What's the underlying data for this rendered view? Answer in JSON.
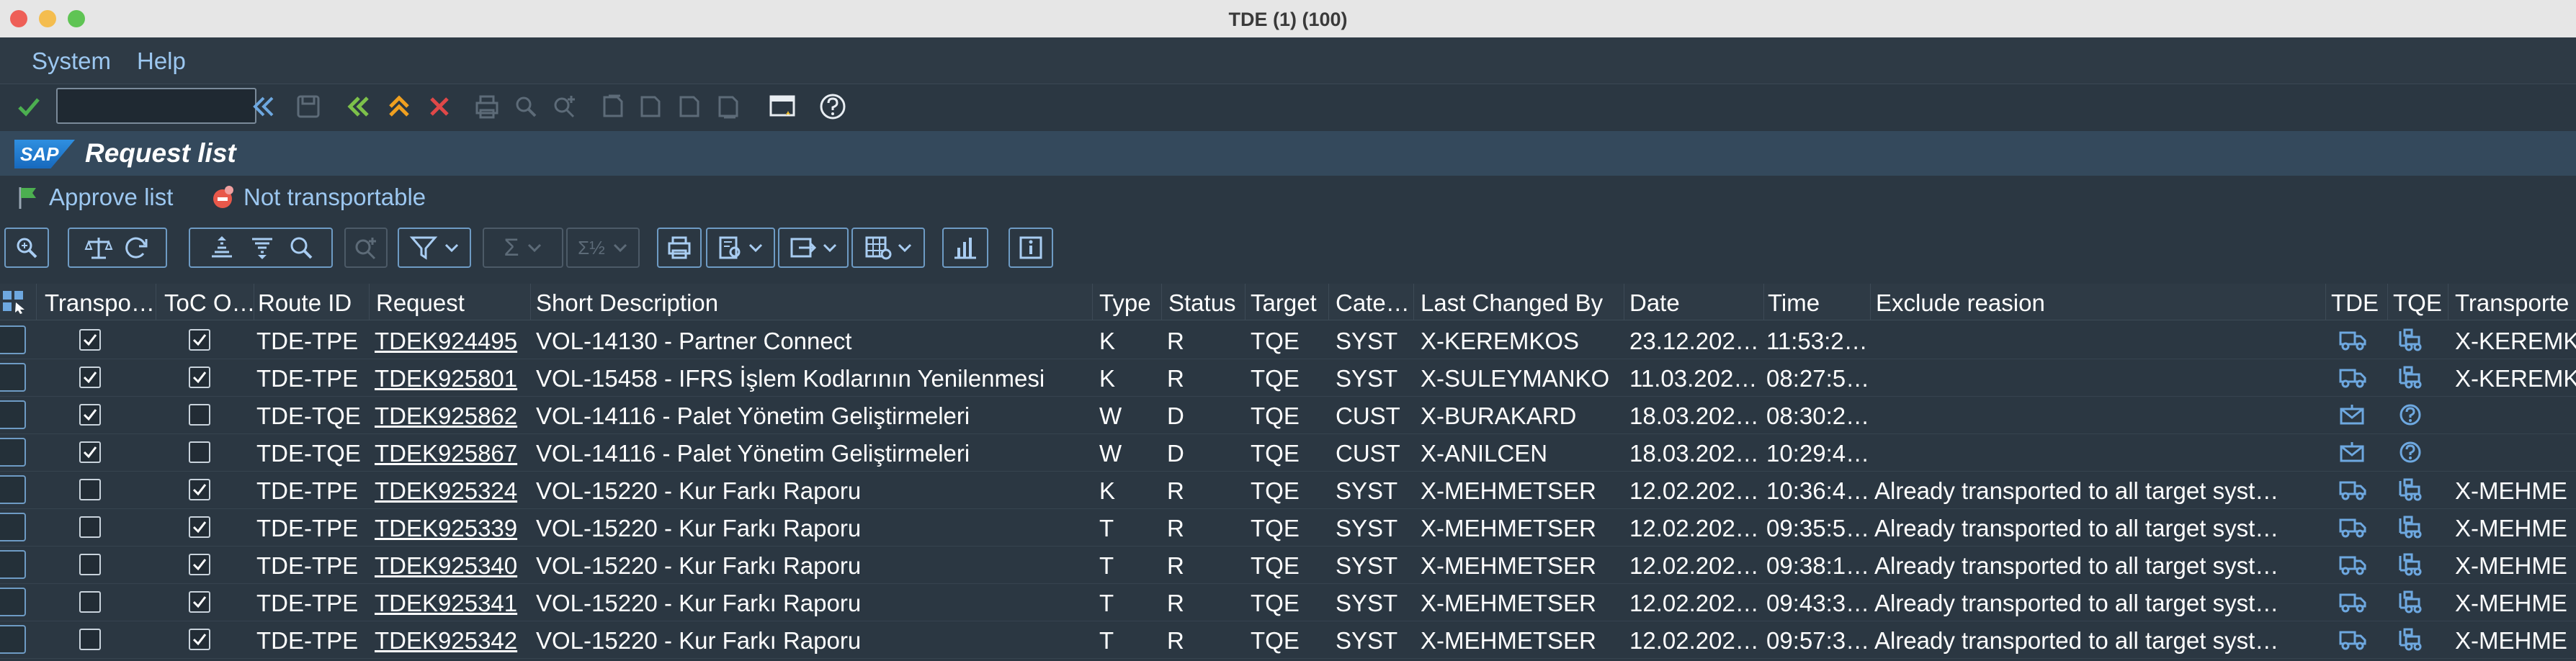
{
  "window": {
    "title": "TDE (1) (100)"
  },
  "menu": {
    "items": [
      "System",
      "Help"
    ]
  },
  "command_field": {
    "value": ""
  },
  "header": {
    "title": "Request list",
    "logo_text": "SAP"
  },
  "app_toolbar": {
    "approve_label": "Approve list",
    "not_transportable_label": "Not transportable"
  },
  "colors": {
    "link": "#9cc7f0",
    "background": "#2b3742",
    "header_bg": "#34495c",
    "approve_ok": "#4caf50",
    "cancel_red": "#e04848"
  },
  "table": {
    "columns": [
      "Transpo…",
      "ToC O…",
      "Route ID",
      "Request",
      "Short Description",
      "Type",
      "Status",
      "Target",
      "Cate…",
      "Last Changed By",
      "Date",
      "Time",
      "Exclude reasion",
      "TDE",
      "TQE",
      "Transporte"
    ],
    "rows": [
      {
        "transport": true,
        "toc": true,
        "route": "TDE-TPE",
        "request": "TDEK924495",
        "desc": "VOL-14130 - Partner Connect",
        "type": "K",
        "status": "R",
        "target": "TQE",
        "cate": "SYST",
        "changed_by": "X-KEREMKOS",
        "date": "23.12.202…",
        "time": "11:53:2…",
        "exclude": "",
        "tde_icon": "truck-icon",
        "tqe_icon": "forklift-icon",
        "transporter": "X-KEREMK"
      },
      {
        "transport": true,
        "toc": true,
        "route": "TDE-TPE",
        "request": "TDEK925801",
        "desc": "VOL-15458 -  IFRS İşlem Kodlarının Yenilenmesi",
        "type": "K",
        "status": "R",
        "target": "TQE",
        "cate": "SYST",
        "changed_by": "X-SULEYMANKO",
        "date": "11.03.202…",
        "time": "08:27:5…",
        "exclude": "",
        "tde_icon": "truck-icon",
        "tqe_icon": "forklift-icon",
        "transporter": "X-KEREMK"
      },
      {
        "transport": true,
        "toc": false,
        "route": "TDE-TQE",
        "request": "TDEK925862",
        "desc": "VOL-14116 - Palet Yönetim Geliştirmeleri",
        "type": "W",
        "status": "D",
        "target": "TQE",
        "cate": "CUST",
        "changed_by": "X-BURAKARD",
        "date": "18.03.202…",
        "time": "08:30:2…",
        "exclude": "",
        "tde_icon": "envelope-icon",
        "tqe_icon": "question-icon",
        "transporter": ""
      },
      {
        "transport": true,
        "toc": false,
        "route": "TDE-TQE",
        "request": "TDEK925867",
        "desc": "VOL-14116 - Palet Yönetim Geliştirmeleri",
        "type": "W",
        "status": "D",
        "target": "TQE",
        "cate": "CUST",
        "changed_by": "X-ANILCEN",
        "date": "18.03.202…",
        "time": "10:29:4…",
        "exclude": "",
        "tde_icon": "envelope-icon",
        "tqe_icon": "question-icon",
        "transporter": ""
      },
      {
        "transport": false,
        "toc": true,
        "route": "TDE-TPE",
        "request": "TDEK925324",
        "desc": "VOL-15220 - Kur Farkı Raporu",
        "type": "K",
        "status": "R",
        "target": "TQE",
        "cate": "SYST",
        "changed_by": "X-MEHMETSER",
        "date": "12.02.202…",
        "time": "10:36:4…",
        "exclude": "Already transported to all target syst…",
        "tde_icon": "truck-icon",
        "tqe_icon": "forklift-icon",
        "transporter": "X-MEHME"
      },
      {
        "transport": false,
        "toc": true,
        "route": "TDE-TPE",
        "request": "TDEK925339",
        "desc": "VOL-15220 - Kur Farkı Raporu",
        "type": "T",
        "status": "R",
        "target": "TQE",
        "cate": "SYST",
        "changed_by": "X-MEHMETSER",
        "date": "12.02.202…",
        "time": "09:35:5…",
        "exclude": "Already transported to all target syst…",
        "tde_icon": "truck-icon",
        "tqe_icon": "forklift-icon",
        "transporter": "X-MEHME"
      },
      {
        "transport": false,
        "toc": true,
        "route": "TDE-TPE",
        "request": "TDEK925340",
        "desc": "VOL-15220 - Kur Farkı Raporu",
        "type": "T",
        "status": "R",
        "target": "TQE",
        "cate": "SYST",
        "changed_by": "X-MEHMETSER",
        "date": "12.02.202…",
        "time": "09:38:1…",
        "exclude": "Already transported to all target syst…",
        "tde_icon": "truck-icon",
        "tqe_icon": "forklift-icon",
        "transporter": "X-MEHME"
      },
      {
        "transport": false,
        "toc": true,
        "route": "TDE-TPE",
        "request": "TDEK925341",
        "desc": "VOL-15220 - Kur Farkı Raporu",
        "type": "T",
        "status": "R",
        "target": "TQE",
        "cate": "SYST",
        "changed_by": "X-MEHMETSER",
        "date": "12.02.202…",
        "time": "09:43:3…",
        "exclude": "Already transported to all target syst…",
        "tde_icon": "truck-icon",
        "tqe_icon": "forklift-icon",
        "transporter": "X-MEHME"
      },
      {
        "transport": false,
        "toc": true,
        "route": "TDE-TPE",
        "request": "TDEK925342",
        "desc": "VOL-15220 - Kur Farkı Raporu",
        "type": "T",
        "status": "R",
        "target": "TQE",
        "cate": "SYST",
        "changed_by": "X-MEHMETSER",
        "date": "12.02.202…",
        "time": "09:57:3…",
        "exclude": "Already transported to all target syst…",
        "tde_icon": "truck-icon",
        "tqe_icon": "forklift-icon",
        "transporter": "X-MEHME"
      }
    ]
  }
}
